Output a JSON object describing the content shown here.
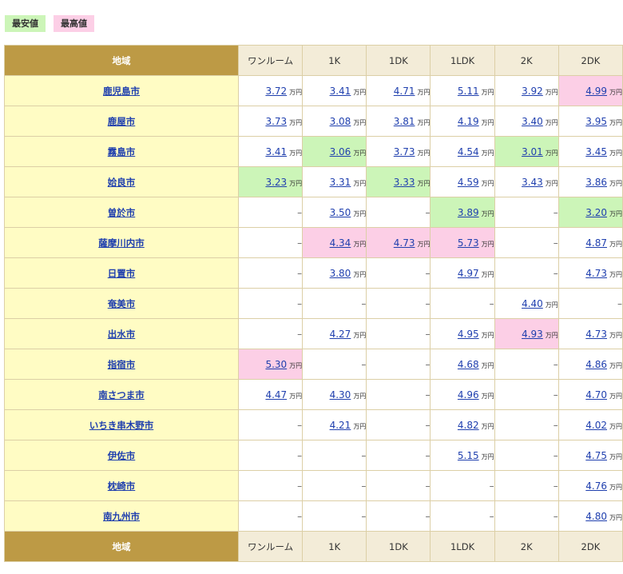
{
  "legend": {
    "lowest_label": "最安値",
    "highest_label": "最高値",
    "lowest_color": "#ccf5b8",
    "highest_color": "#fccfe6"
  },
  "header": {
    "region_label": "地域",
    "columns": [
      "ワンルーム",
      "1K",
      "1DK",
      "1LDK",
      "2K",
      "2DK"
    ]
  },
  "unit": "万円",
  "dash": "–",
  "rows": [
    {
      "region": "鹿児島市",
      "values": [
        "3.72",
        "3.41",
        "4.71",
        "5.11",
        "3.92",
        "4.99"
      ],
      "marks": [
        "",
        "",
        "",
        "",
        "",
        "high"
      ]
    },
    {
      "region": "鹿屋市",
      "values": [
        "3.73",
        "3.08",
        "3.81",
        "4.19",
        "3.40",
        "3.95"
      ],
      "marks": [
        "",
        "",
        "",
        "",
        "",
        ""
      ]
    },
    {
      "region": "霧島市",
      "values": [
        "3.41",
        "3.06",
        "3.73",
        "4.54",
        "3.01",
        "3.45"
      ],
      "marks": [
        "",
        "low",
        "",
        "",
        "low",
        ""
      ]
    },
    {
      "region": "姶良市",
      "values": [
        "3.23",
        "3.31",
        "3.33",
        "4.59",
        "3.43",
        "3.86"
      ],
      "marks": [
        "low",
        "",
        "low",
        "",
        "",
        ""
      ]
    },
    {
      "region": "曽於市",
      "values": [
        null,
        "3.50",
        null,
        "3.89",
        null,
        "3.20"
      ],
      "marks": [
        "",
        "",
        "",
        "low",
        "",
        "low"
      ]
    },
    {
      "region": "薩摩川内市",
      "values": [
        null,
        "4.34",
        "4.73",
        "5.73",
        null,
        "4.87"
      ],
      "marks": [
        "",
        "high",
        "high",
        "high",
        "",
        ""
      ]
    },
    {
      "region": "日置市",
      "values": [
        null,
        "3.80",
        null,
        "4.97",
        null,
        "4.73"
      ],
      "marks": [
        "",
        "",
        "",
        "",
        "",
        ""
      ]
    },
    {
      "region": "奄美市",
      "values": [
        null,
        null,
        null,
        null,
        "4.40",
        null
      ],
      "marks": [
        "",
        "",
        "",
        "",
        "",
        ""
      ]
    },
    {
      "region": "出水市",
      "values": [
        null,
        "4.27",
        null,
        "4.95",
        "4.93",
        "4.73"
      ],
      "marks": [
        "",
        "",
        "",
        "",
        "high",
        ""
      ]
    },
    {
      "region": "指宿市",
      "values": [
        "5.30",
        null,
        null,
        "4.68",
        null,
        "4.86"
      ],
      "marks": [
        "high",
        "",
        "",
        "",
        "",
        ""
      ]
    },
    {
      "region": "南さつま市",
      "values": [
        "4.47",
        "4.30",
        null,
        "4.96",
        null,
        "4.70"
      ],
      "marks": [
        "",
        "",
        "",
        "",
        "",
        ""
      ]
    },
    {
      "region": "いちき串木野市",
      "values": [
        null,
        "4.21",
        null,
        "4.82",
        null,
        "4.02"
      ],
      "marks": [
        "",
        "",
        "",
        "",
        "",
        ""
      ]
    },
    {
      "region": "伊佐市",
      "values": [
        null,
        null,
        null,
        "5.15",
        null,
        "4.75"
      ],
      "marks": [
        "",
        "",
        "",
        "",
        "",
        ""
      ]
    },
    {
      "region": "枕崎市",
      "values": [
        null,
        null,
        null,
        null,
        null,
        "4.76"
      ],
      "marks": [
        "",
        "",
        "",
        "",
        "",
        ""
      ]
    },
    {
      "region": "南九州市",
      "values": [
        null,
        null,
        null,
        null,
        null,
        "4.80"
      ],
      "marks": [
        "",
        "",
        "",
        "",
        "",
        ""
      ]
    }
  ]
}
